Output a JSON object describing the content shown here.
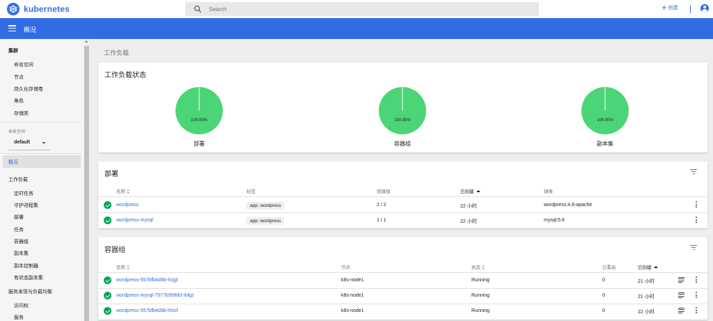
{
  "app": {
    "brand": "kubernetes"
  },
  "search": {
    "placeholder": "Search"
  },
  "toolbar": {
    "create_label": "创建"
  },
  "header": {
    "title": "概况"
  },
  "sidebar": {
    "cluster": {
      "heading": "集群",
      "items": [
        "命名空间",
        "节点",
        "持久化存储卷",
        "角色",
        "存储类"
      ]
    },
    "namespace": {
      "label": "命名空间",
      "selected": "default"
    },
    "overview": "概况",
    "workloads": {
      "heading": "工作负载",
      "items": [
        "定时任务",
        "守护进程集",
        "部署",
        "任务",
        "容器组",
        "副本集",
        "副本控制器",
        "有状态副本集"
      ]
    },
    "discovery": {
      "heading": "服务发现与负载均衡",
      "items": [
        "访问权",
        "服务"
      ]
    }
  },
  "breadcrumb": "工作负载",
  "status_card": {
    "title": "工作负载状态",
    "pies": [
      {
        "name": "部署",
        "label": "100.00%",
        "percent": 100
      },
      {
        "name": "容器组",
        "label": "100.00%",
        "percent": 100
      },
      {
        "name": "副本集",
        "label": "100.00%",
        "percent": 100
      }
    ],
    "color": "#4cd577"
  },
  "deployments": {
    "title": "部署",
    "columns": {
      "name": "名称",
      "labels": "标签",
      "pods": "容器组",
      "created": "已创建",
      "image": "镜像"
    },
    "rows": [
      {
        "name": "wordpress",
        "label": "app: wordpress",
        "pods": "2 / 2",
        "created": "22 小时",
        "image": "wordpress:4.8-apache"
      },
      {
        "name": "wordpress-mysql",
        "label": "app: wordpress",
        "pods": "1 / 1",
        "created": "22 小时",
        "image": "mysql:5.6"
      }
    ]
  },
  "pods": {
    "title": "容器组",
    "columns": {
      "name": "名称",
      "node": "节点",
      "status": "状态",
      "restarts": "已重启",
      "created": "已创建"
    },
    "rows": [
      {
        "name": "wordpress-557bfb4d8b-9zjgl",
        "node": "k8s-node1",
        "status": "Running",
        "restarts": "0",
        "created": "21 小时"
      },
      {
        "name": "wordpress-mysql-7977b9588d-rblgz",
        "node": "k8s-node1",
        "status": "Running",
        "restarts": "0",
        "created": "21 小时"
      },
      {
        "name": "wordpress-557bfb4d8b-hlncf",
        "node": "k8s-node1",
        "status": "Running",
        "restarts": "0",
        "created": "22 小时"
      }
    ]
  },
  "colors": {
    "brand": "#326ce5",
    "ok": "#00a650",
    "pie": "#4cd577"
  }
}
